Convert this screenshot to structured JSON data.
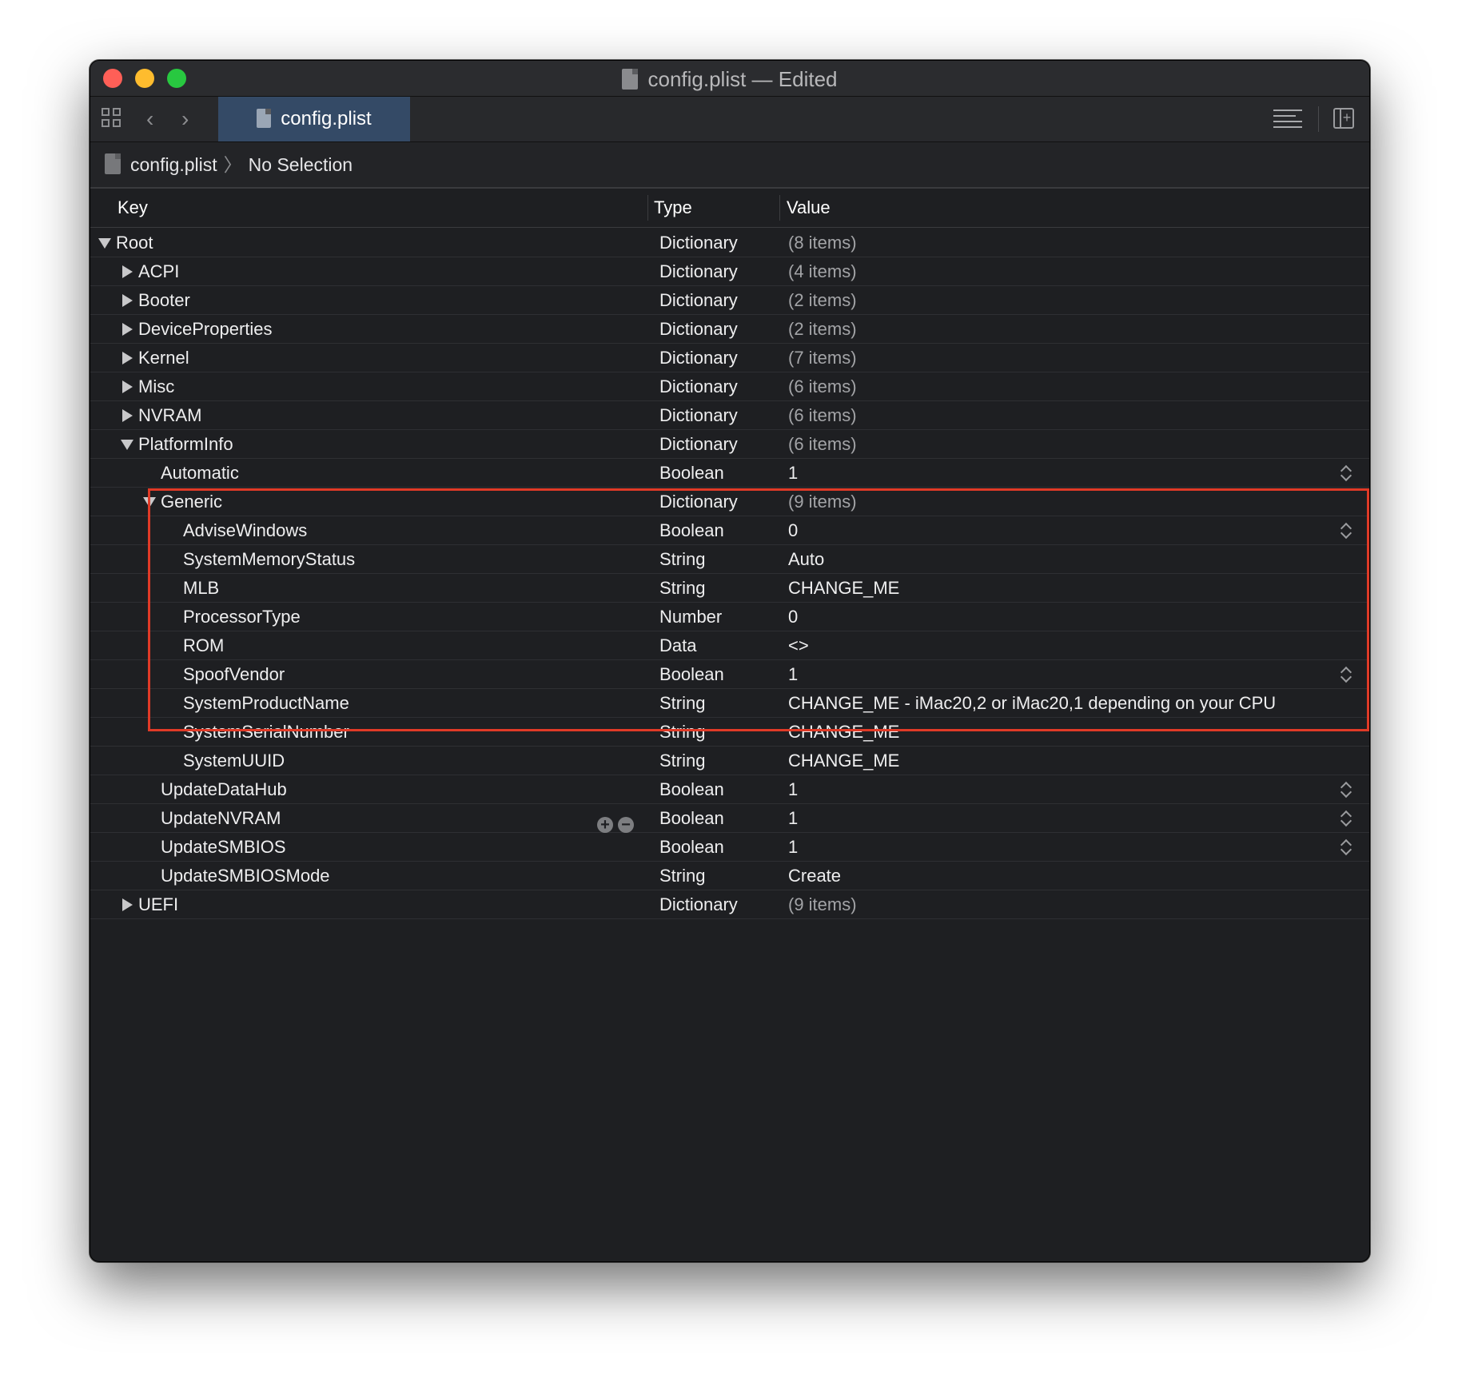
{
  "window": {
    "title": "config.plist — Edited",
    "tab_label": "config.plist"
  },
  "breadcrumb": {
    "file": "config.plist",
    "separator": "〉",
    "selection": "No Selection"
  },
  "columns": {
    "key": "Key",
    "type": "Type",
    "value": "Value"
  },
  "rows": [
    {
      "key": "Root",
      "type": "Dictionary",
      "value": "(8 items)",
      "level": 0,
      "disclosure": "open",
      "dim": true
    },
    {
      "key": "ACPI",
      "type": "Dictionary",
      "value": "(4 items)",
      "level": 1,
      "disclosure": "closed",
      "dim": true
    },
    {
      "key": "Booter",
      "type": "Dictionary",
      "value": "(2 items)",
      "level": 1,
      "disclosure": "closed",
      "dim": true
    },
    {
      "key": "DeviceProperties",
      "type": "Dictionary",
      "value": "(2 items)",
      "level": 1,
      "disclosure": "closed",
      "dim": true
    },
    {
      "key": "Kernel",
      "type": "Dictionary",
      "value": "(7 items)",
      "level": 1,
      "disclosure": "closed",
      "dim": true
    },
    {
      "key": "Misc",
      "type": "Dictionary",
      "value": "(6 items)",
      "level": 1,
      "disclosure": "closed",
      "dim": true
    },
    {
      "key": "NVRAM",
      "type": "Dictionary",
      "value": "(6 items)",
      "level": 1,
      "disclosure": "closed",
      "dim": true
    },
    {
      "key": "PlatformInfo",
      "type": "Dictionary",
      "value": "(6 items)",
      "level": 1,
      "disclosure": "open",
      "dim": true
    },
    {
      "key": "Automatic",
      "type": "Boolean",
      "value": "1",
      "level": 2,
      "stepper": true
    },
    {
      "key": "Generic",
      "type": "Dictionary",
      "value": "(9 items)",
      "level": 2,
      "disclosure": "open",
      "dim": true
    },
    {
      "key": "AdviseWindows",
      "type": "Boolean",
      "value": "0",
      "level": 3,
      "stepper": true
    },
    {
      "key": "SystemMemoryStatus",
      "type": "String",
      "value": "Auto",
      "level": 3
    },
    {
      "key": "MLB",
      "type": "String",
      "value": "CHANGE_ME",
      "level": 3
    },
    {
      "key": "ProcessorType",
      "type": "Number",
      "value": "0",
      "level": 3
    },
    {
      "key": "ROM",
      "type": "Data",
      "value": "<>",
      "level": 3
    },
    {
      "key": "SpoofVendor",
      "type": "Boolean",
      "value": "1",
      "level": 3,
      "stepper": true
    },
    {
      "key": "SystemProductName",
      "type": "String",
      "value": "CHANGE_ME - iMac20,2 or iMac20,1 depending on your CPU",
      "level": 3
    },
    {
      "key": "SystemSerialNumber",
      "type": "String",
      "value": "CHANGE_ME",
      "level": 3
    },
    {
      "key": "SystemUUID",
      "type": "String",
      "value": "CHANGE_ME",
      "level": 3
    },
    {
      "key": "UpdateDataHub",
      "type": "Boolean",
      "value": "1",
      "level": 2,
      "stepper": true
    },
    {
      "key": "UpdateNVRAM",
      "type": "Boolean",
      "value": "1",
      "level": 2,
      "stepper": true,
      "addremove": true
    },
    {
      "key": "UpdateSMBIOS",
      "type": "Boolean",
      "value": "1",
      "level": 2,
      "stepper": true
    },
    {
      "key": "UpdateSMBIOSMode",
      "type": "String",
      "value": "Create",
      "level": 2
    },
    {
      "key": "UEFI",
      "type": "Dictionary",
      "value": "(9 items)",
      "level": 1,
      "disclosure": "closed",
      "dim": true
    }
  ],
  "colors": {
    "highlight": "#e03a27",
    "tab_active": "#344a66",
    "background": "#1e1f22"
  }
}
